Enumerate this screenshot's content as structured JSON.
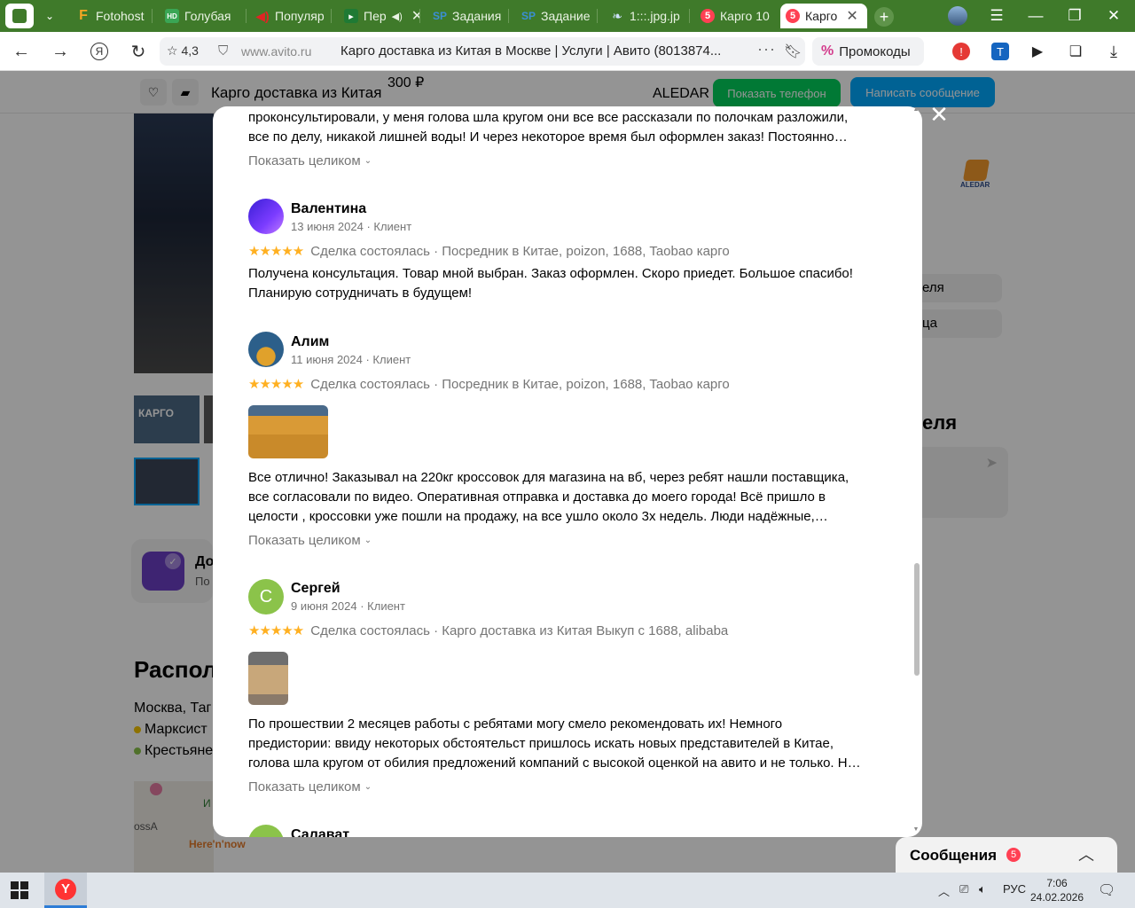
{
  "browser": {
    "tabs": [
      {
        "label": "",
        "favicon": "gs-icon",
        "active": false
      },
      {
        "label": "Fotohost",
        "favicon": "F",
        "fav_color": "#f5a623",
        "active": false
      },
      {
        "label": "Голубая",
        "favicon": "HD",
        "fav_color": "#3aa655",
        "active": false
      },
      {
        "label": "Популяр",
        "favicon": "speaker",
        "fav_color": "#e02424",
        "active": false
      },
      {
        "label": "Пер",
        "favicon": "green",
        "fav_color": "#1f7a34",
        "active": false
      },
      {
        "label": "Задания",
        "favicon": "SP",
        "fav_color": "#3b8fd4",
        "active": false
      },
      {
        "label": "Задание",
        "favicon": "SP",
        "fav_color": "#3b8fd4",
        "active": false
      },
      {
        "label": "1:::.jpg.jp",
        "favicon": "feather",
        "fav_color": "#2d7cd6",
        "active": false
      },
      {
        "label": "Карго 10",
        "favicon": "5",
        "fav_color": "#ff4053",
        "active": false
      },
      {
        "label": "Карго",
        "favicon": "5",
        "fav_color": "#ff4053",
        "active": true
      }
    ],
    "address": {
      "rating": "4,3",
      "domain": "www.avito.ru",
      "title": "Карго доставка из Китая в Москве | Услуги | Авито (8013874...",
      "promo_label": "Промокоды"
    }
  },
  "page": {
    "sticky": {
      "title": "Карго доставка из Китая",
      "price": "300 ₽",
      "seller": "ALEDAR",
      "phone_button": "Показать телефон",
      "message_button": "Написать сообщение"
    },
    "thumb_text": "КАРГО",
    "promo_card": {
      "title": "До",
      "subtitle": "По"
    },
    "location": {
      "heading": "Распол",
      "city": "Москва, Таг",
      "metro": [
        {
          "name": "Марксист",
          "color": "#f5c400"
        },
        {
          "name": "Крестьяне",
          "color": "#8bc34a"
        }
      ],
      "map_labels": [
        "ossA",
        "Here'n'now",
        "И"
      ]
    },
    "right_col": {
      "items": [
        "еля",
        "ца"
      ],
      "heading": "еля"
    },
    "logo_text": "ALEDAR"
  },
  "modal": {
    "first_review_tail": [
      "проконсультировали, у меня голова шла кругом они все все рассказали по полочкам разложили,",
      "все по делу, никакой лишней воды! И через некоторое время был оформлен заказ! Постоянно…"
    ],
    "show_full_label": "Показать целиком",
    "reviews": [
      {
        "name": "Валентина",
        "meta": "13 июня 2024 · Клиент",
        "stars": "★★★★★",
        "deal": "Сделка состоялась · Посредник в Китае, poizon, 1688, Taobao карго",
        "text": [
          "Получена консультация. Товар мной выбран. Заказ оформлен. Скоро приедет. Большое спасибо!",
          "Планирую сотрудничать в будущем!"
        ]
      },
      {
        "name": "Алим",
        "meta": "11 июня 2024 · Клиент",
        "stars": "★★★★★",
        "deal": "Сделка состоялась · Посредник в Китае, poizon, 1688, Taobao карго",
        "text": [
          "Все отлично! Заказывал на 220кг кроссовок для магазина на вб, через ребят нашли поставщика,",
          "все согласовали по видео. Оперативная отправка и доставка до моего города! Всё пришло в",
          "целости , кроссовки уже пошли на продажу, на все ушло около 3х недель. Люди надёжные,…"
        ]
      },
      {
        "name": "Сергей",
        "initial": "С",
        "meta": "9 июня 2024 · Клиент",
        "stars": "★★★★★",
        "deal": "Сделка состоялась · Карго доставка из Китая Выкуп с 1688, alibaba",
        "text": [
          "По прошествии 2 месяцев работы с ребятами могу смело рекомендовать их! Немного",
          "предистории: ввиду некоторых обстоятельст пришлось искать новых представителей в Китае,",
          "голова шла кругом от обилия предложений компаний с высокой оценкой на авито и не только. Н…"
        ]
      },
      {
        "name": "Салават"
      }
    ]
  },
  "drawer": {
    "title": "Сообщения",
    "badge": "5"
  },
  "taskbar": {
    "lang": "РУС",
    "time": "7:06",
    "date": "24.02.2026"
  },
  "colors": {
    "tabbar": "#3f7a2a",
    "avito_green": "#02d15c",
    "avito_blue": "#00aaff",
    "star": "#ffb021",
    "muted": "#757575"
  }
}
